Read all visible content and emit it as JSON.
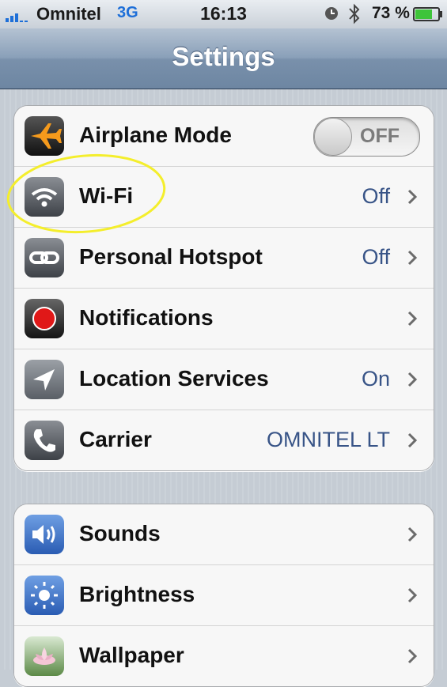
{
  "status_bar": {
    "carrier": "Omnitel",
    "network": "3G",
    "time": "16:13",
    "battery": "73 %"
  },
  "nav": {
    "title": "Settings"
  },
  "group1": [
    {
      "label": "Airplane Mode",
      "icon": "airplane-icon",
      "toggle": "OFF"
    },
    {
      "label": "Wi-Fi",
      "icon": "wifi-icon",
      "value": "Off"
    },
    {
      "label": "Personal Hotspot",
      "icon": "hotspot-icon",
      "value": "Off"
    },
    {
      "label": "Notifications",
      "icon": "notifications-icon"
    },
    {
      "label": "Location Services",
      "icon": "location-icon",
      "value": "On"
    },
    {
      "label": "Carrier",
      "icon": "phone-icon",
      "value": "OMNITEL LT"
    }
  ],
  "group2": [
    {
      "label": "Sounds",
      "icon": "sounds-icon"
    },
    {
      "label": "Brightness",
      "icon": "brightness-icon"
    },
    {
      "label": "Wallpaper",
      "icon": "wallpaper-icon"
    }
  ],
  "colors": {
    "value_text": "#385487",
    "annotation": "#f4ee2c",
    "network": "#1e6fd8"
  }
}
